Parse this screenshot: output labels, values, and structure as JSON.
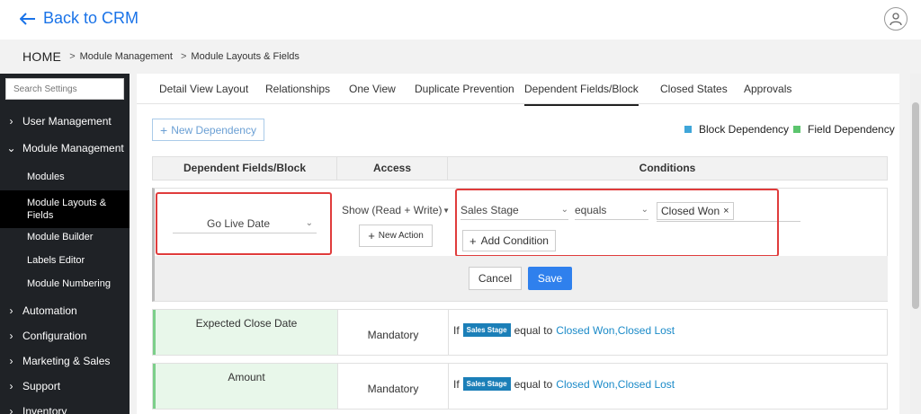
{
  "header": {
    "back_label": "Back to CRM"
  },
  "breadcrumb": {
    "home": "HOME",
    "items": [
      "Module Management",
      "Module Layouts & Fields"
    ]
  },
  "sidebar": {
    "search_placeholder": "Search Settings",
    "items": [
      {
        "label": "User Management",
        "state": "collapsed"
      },
      {
        "label": "Module Management",
        "state": "expanded"
      }
    ],
    "subitems": [
      "Modules",
      "Module Layouts &",
      "Fields",
      "Module Builder",
      "Labels Editor",
      "Module Numbering"
    ],
    "more": [
      "Automation",
      "Configuration",
      "Marketing & Sales",
      "Support",
      "Inventory"
    ]
  },
  "tabs": [
    "Detail View Layout",
    "Relationships",
    "One View",
    "Duplicate Prevention",
    "Dependent Fields/Block",
    "Closed States",
    "Approvals"
  ],
  "active_tab": "Dependent Fields/Block",
  "toolbar": {
    "new_dependency": "New Dependency"
  },
  "legend": [
    {
      "label": "Block Dependency",
      "color": "#3fa6d9"
    },
    {
      "label": "Field Dependency",
      "color": "#5cc56e"
    }
  ],
  "table": {
    "headers": [
      "Dependent Fields/Block",
      "Access",
      "Conditions"
    ]
  },
  "edit_row": {
    "field_value": "Go Live Date",
    "access_value": "Show (Read + Write)",
    "new_action": "New Action",
    "condition_field": "Sales Stage",
    "condition_operator": "equals",
    "condition_chip": "Closed Won",
    "add_condition": "Add Condition",
    "cancel": "Cancel",
    "save": "Save"
  },
  "rows": [
    {
      "field": "Expected Close Date",
      "access": "Mandatory",
      "if": "If",
      "tag": "Sales Stage",
      "equal_to": "equal to",
      "values": "Closed Won,Closed Lost"
    },
    {
      "field": "Amount",
      "access": "Mandatory",
      "if": "If",
      "tag": "Sales Stage",
      "equal_to": "equal to",
      "values": "Closed Won,Closed Lost"
    }
  ],
  "colors": {
    "accent": "#1a73e8",
    "save": "#2f80ed",
    "highlight_box": "#e03c3c",
    "sidebar_bg": "#1f2226"
  }
}
